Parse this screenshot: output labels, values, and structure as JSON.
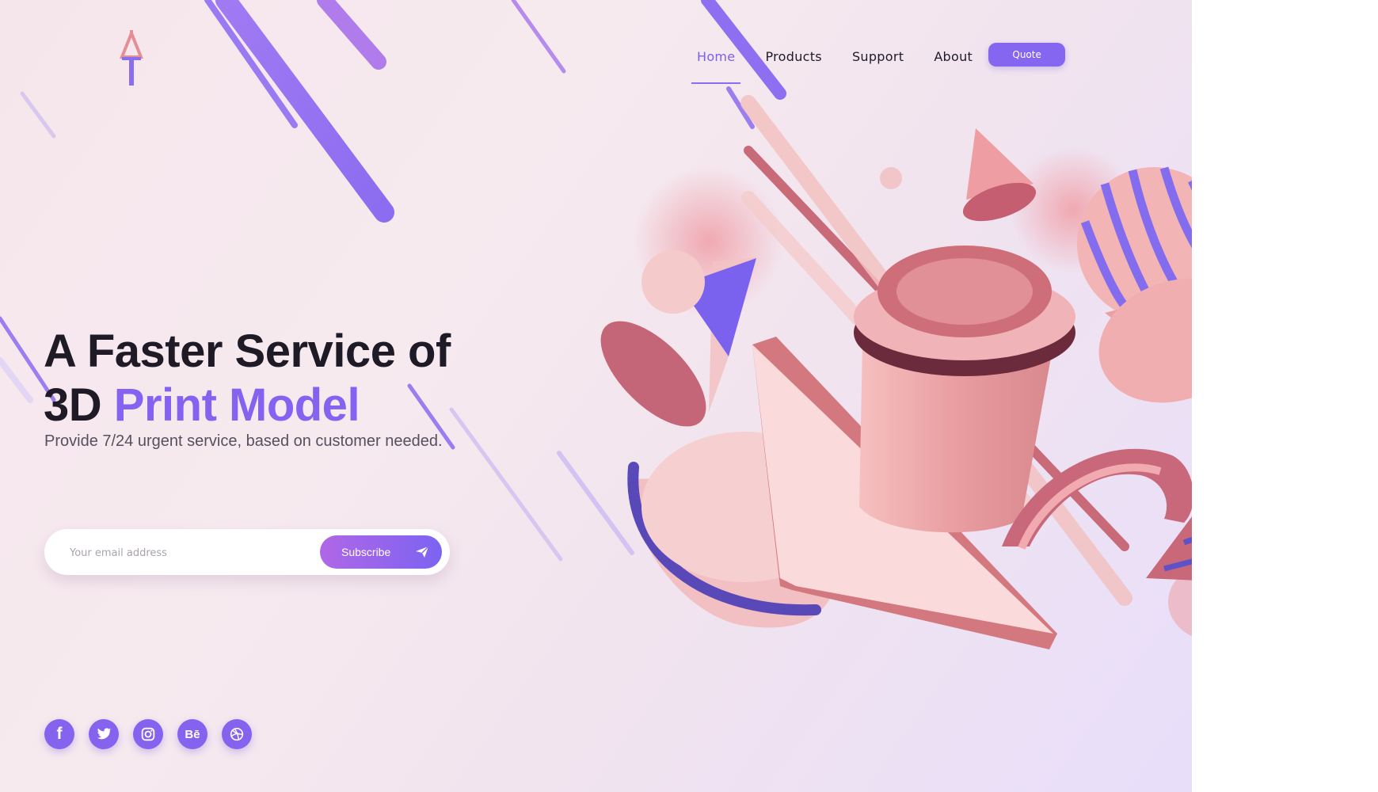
{
  "nav": {
    "items": [
      {
        "label": "Home",
        "active": true
      },
      {
        "label": "Products",
        "active": false
      },
      {
        "label": "Support",
        "active": false
      },
      {
        "label": "About",
        "active": false
      }
    ],
    "quote_label": "Quote"
  },
  "hero": {
    "title_line1": "A Faster Service of",
    "title_line2_prefix": "3D",
    "title_line2_accent": "Print Model",
    "subtitle": "Provide 7/24 urgent service, based on customer needed."
  },
  "subscribe": {
    "placeholder": "Your email address",
    "button_label": "Subscribe"
  },
  "social": [
    {
      "icon": "facebook-icon",
      "glyph": "f"
    },
    {
      "icon": "twitter-icon"
    },
    {
      "icon": "instagram-icon"
    },
    {
      "icon": "behance-icon",
      "glyph": "Bē"
    },
    {
      "icon": "dribbble-icon"
    }
  ],
  "colors": {
    "accent": "#8563f0",
    "pink": "#e8a0a6",
    "background": "#f5e6ec"
  }
}
